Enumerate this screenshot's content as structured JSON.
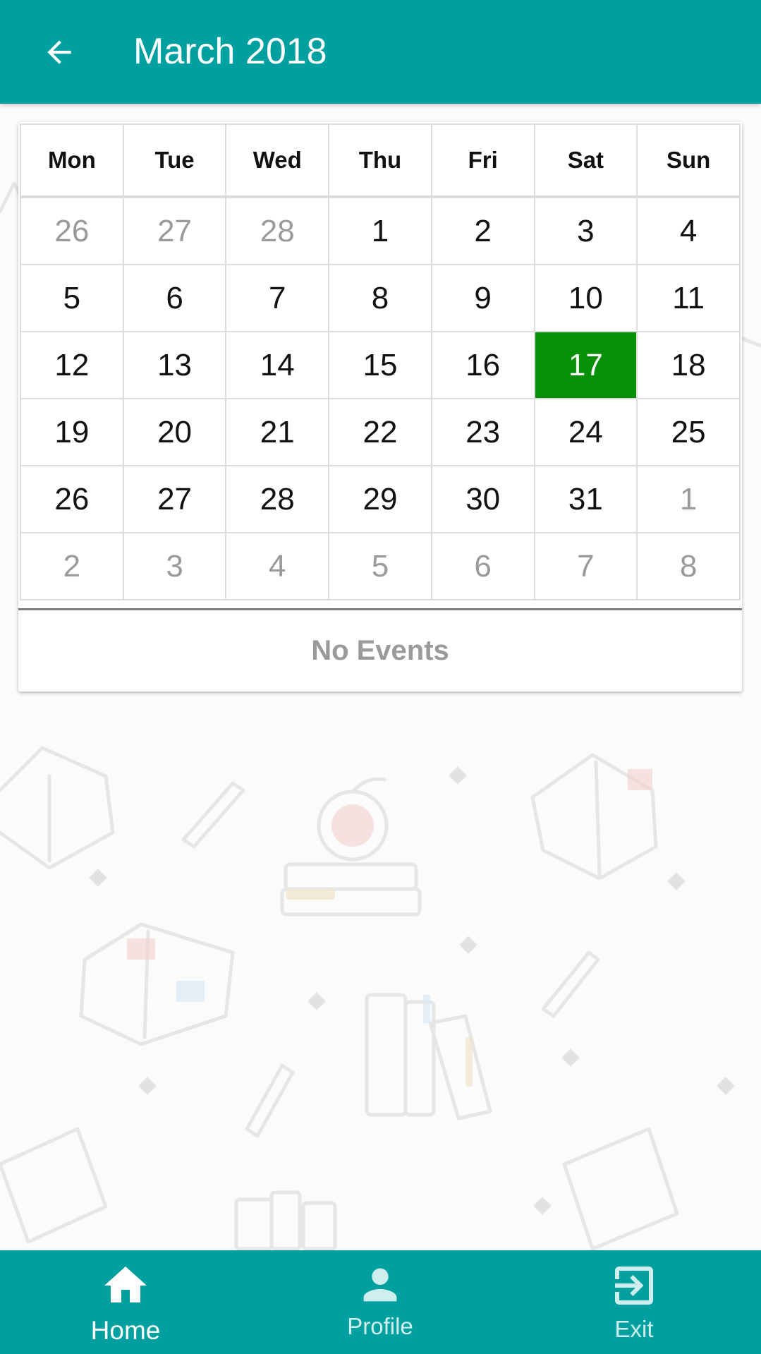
{
  "app_bar": {
    "title": "March 2018",
    "back_icon": "arrow-left-icon"
  },
  "calendar": {
    "weekdays": [
      "Mon",
      "Tue",
      "Wed",
      "Thu",
      "Fri",
      "Sat",
      "Sun"
    ],
    "weeks": [
      [
        "26",
        "27",
        "28",
        "1",
        "2",
        "3",
        "4"
      ],
      [
        "5",
        "6",
        "7",
        "8",
        "9",
        "10",
        "11"
      ],
      [
        "12",
        "13",
        "14",
        "15",
        "16",
        "17",
        "18"
      ],
      [
        "19",
        "20",
        "21",
        "22",
        "23",
        "24",
        "25"
      ],
      [
        "26",
        "27",
        "28",
        "29",
        "30",
        "31",
        "1"
      ],
      [
        "2",
        "3",
        "4",
        "5",
        "6",
        "7",
        "8"
      ]
    ],
    "selected_day": "17",
    "selected_color": "#078f07",
    "events_message": "No Events"
  },
  "bottom_nav": {
    "items": [
      {
        "label": "Home",
        "icon": "home-icon",
        "active": true
      },
      {
        "label": "Profile",
        "icon": "profile-icon",
        "active": false
      },
      {
        "label": "Exit",
        "icon": "exit-icon",
        "active": false
      }
    ]
  },
  "colors": {
    "primary": "#00a0a0",
    "muted_text": "#9a9a9a"
  }
}
